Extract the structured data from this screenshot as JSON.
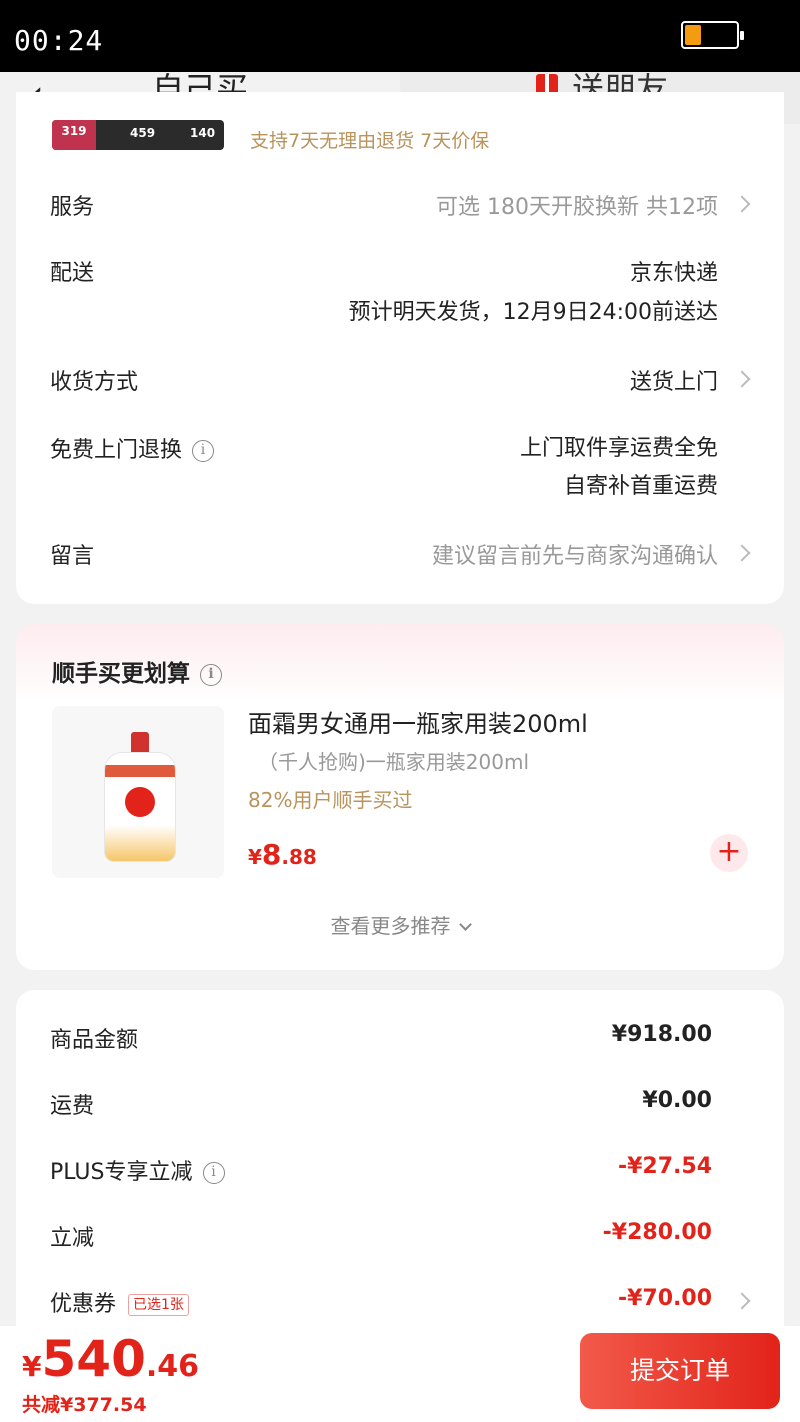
{
  "status_bar": {
    "time": "00:24",
    "battery_level": 0.3
  },
  "header": {
    "back_icon": "‹",
    "tab_self": "自己买",
    "tab_gift": "送朋友"
  },
  "product_strip": {
    "thumb_num1": "319",
    "thumb_num2": "459",
    "thumb_num3": "140",
    "promise": "支持7天无理由退货  7天价保"
  },
  "order_info": {
    "service_label": "服务",
    "service_value": "可选 180天开胶换新 共12项",
    "delivery_label": "配送",
    "delivery_value1": "京东快递",
    "delivery_value2": "预计明天发货，12月9日24:00前送达",
    "receive_label": "收货方式",
    "receive_value": "送货上门",
    "return_label": "免费上门退换",
    "return_value1": "上门取件享运费全免",
    "return_value2": "自寄补首重运费",
    "note_label": "留言",
    "note_value": "建议留言前先与商家沟通确认"
  },
  "recommend": {
    "title": "顺手买更划算",
    "name": "面霜男女通用一瓶家用装200ml",
    "sub": "（千人抢购)一瓶家用装200ml",
    "bought": "82%用户顺手买过",
    "price_cur": "¥",
    "price_int": "8",
    "price_dec": ".88",
    "add_symbol": "+",
    "more": "查看更多推荐"
  },
  "summary": {
    "goods_label": "商品金额",
    "goods_value": "¥918.00",
    "shipping_label": "运费",
    "shipping_value": "¥0.00",
    "plus_label": "PLUS专享立减",
    "plus_value": "-¥27.54",
    "discount_label": "立减",
    "discount_value": "-¥280.00",
    "coupon_label": "优惠券",
    "coupon_tag": "已选1张",
    "coupon_value": "-¥70.00"
  },
  "footer": {
    "total_cur": "¥",
    "total_int": "540",
    "total_dec": ".46",
    "saved": "共减¥377.54",
    "submit": "提交订单"
  },
  "colors": {
    "accent": "#e2231a",
    "gold": "#b8935b"
  }
}
